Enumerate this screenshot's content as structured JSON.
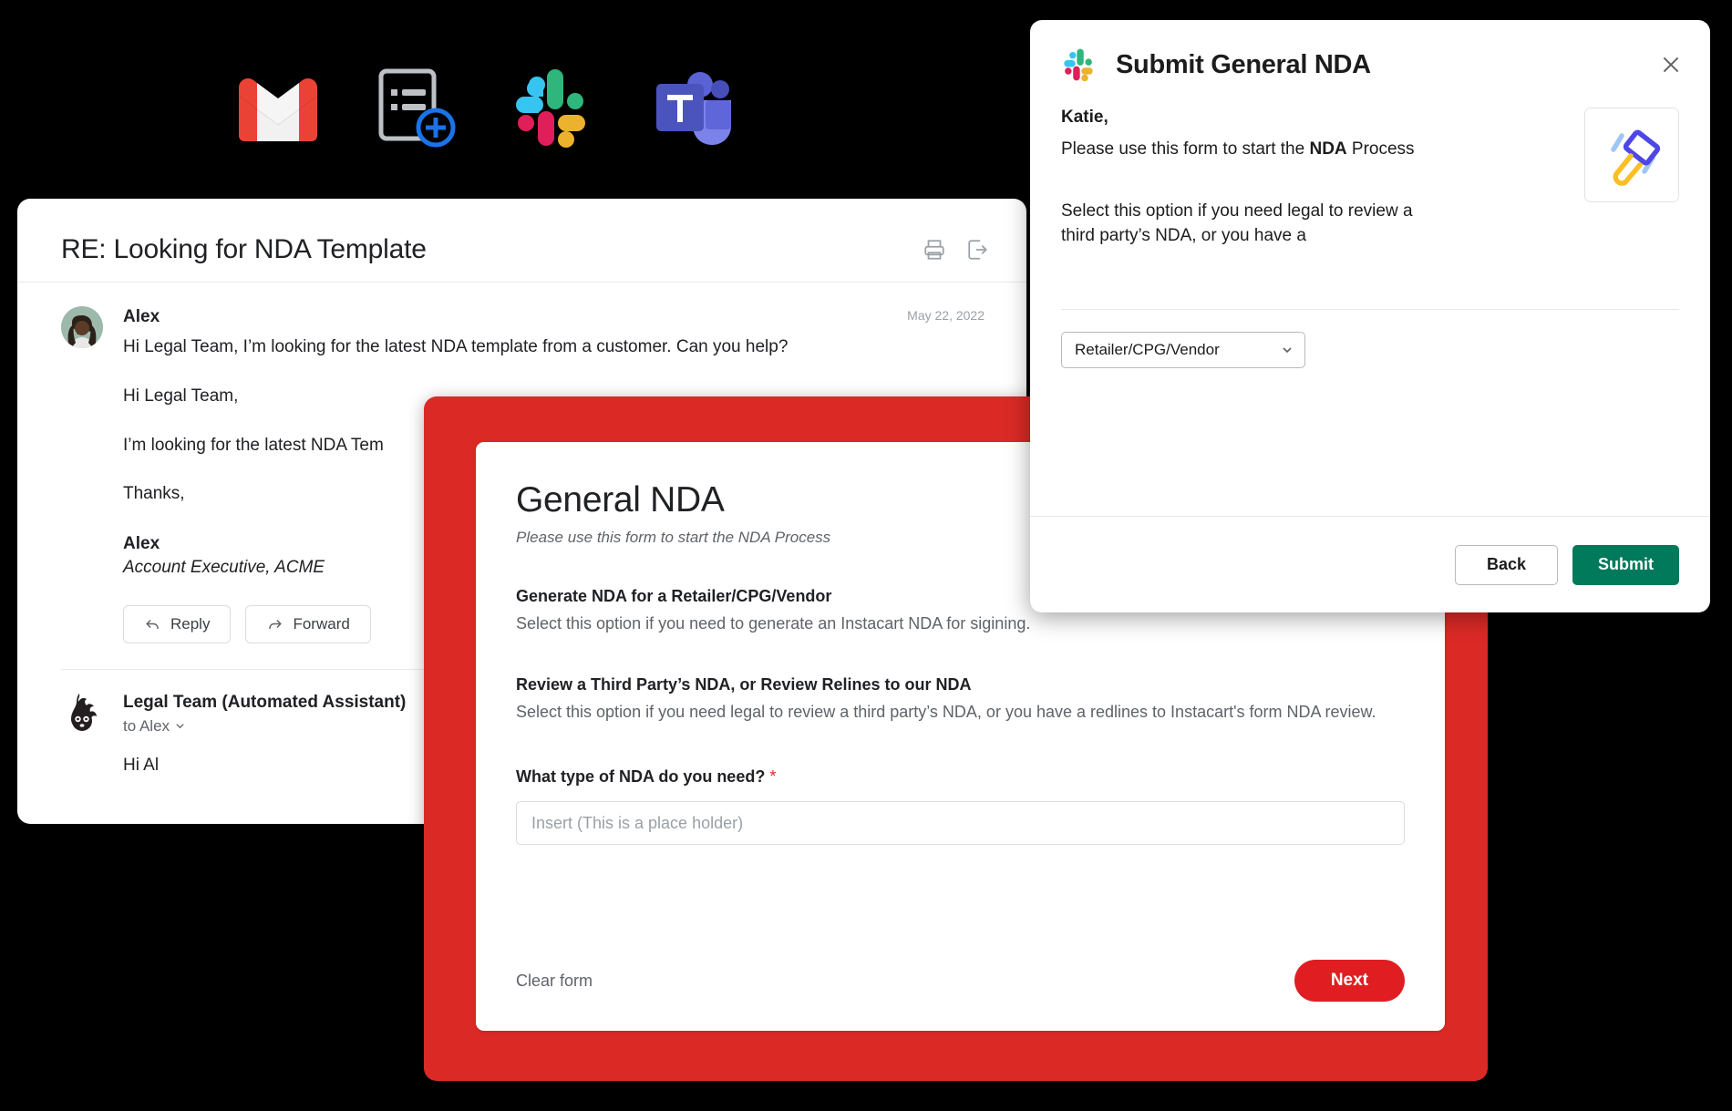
{
  "app_icons": [
    {
      "name": "gmail-icon",
      "label": "Gmail"
    },
    {
      "name": "google-forms-add-icon",
      "label": "New Form"
    },
    {
      "name": "slack-icon",
      "label": "Slack"
    },
    {
      "name": "microsoft-teams-icon",
      "label": "Microsoft Teams"
    }
  ],
  "email": {
    "subject": "RE: Looking for NDA Template",
    "actions": {
      "print": "Print",
      "open_in_new": "Open in new window"
    },
    "messages": [
      {
        "sender": "Alex",
        "date": "May 22, 2022",
        "snippet": "Hi Legal Team, I’m looking for the latest NDA template from a customer. Can you help?",
        "greeting": "Hi Legal Team,",
        "body": "I’m looking for the latest NDA Tem",
        "closing": "Thanks,",
        "signature_name": "Alex",
        "signature_title": "Account Executive, ACME",
        "reply_label": "Reply",
        "forward_label": "Forward"
      },
      {
        "sender": "Legal Team (Automated Assistant)",
        "to": "to Alex",
        "body": "Hi Al"
      }
    ]
  },
  "form": {
    "title": "General NDA",
    "subtitle": "Please use this form to start the NDA Process",
    "blocks": [
      {
        "title": "Generate NDA for a Retailer/CPG/Vendor",
        "description": "Select this option if you need to generate an Instacart NDA for sigining."
      },
      {
        "title": "Review a Third Party’s NDA, or Review Relines to our NDA",
        "description": "Select this option if you need legal to review a third party’s NDA, or you have a redlines to Instacart's form NDA review."
      }
    ],
    "question": "What type of NDA do you need?",
    "required_marker": "*",
    "input_placeholder": "Insert (This is a place holder)",
    "input_value": "",
    "clear_label": "Clear form",
    "next_label": "Next",
    "accent_color": "#e01e22",
    "card_color": "#db2a26"
  },
  "slack_modal": {
    "title": "Submit General NDA",
    "close_label": "Close",
    "greeting": "Katie,",
    "intro_prefix": "Please use this form to start the ",
    "intro_bold": "NDA",
    "intro_suffix": " Process",
    "paragraph": "Select this option if you need legal to review a third party’s NDA, or you have a",
    "thumbnail_icon": "gavel-icon",
    "select_value": "Retailer/CPG/Vendor",
    "select_options": [
      "Retailer/CPG/Vendor"
    ],
    "back_label": "Back",
    "submit_label": "Submit",
    "submit_color": "#007a5a"
  }
}
